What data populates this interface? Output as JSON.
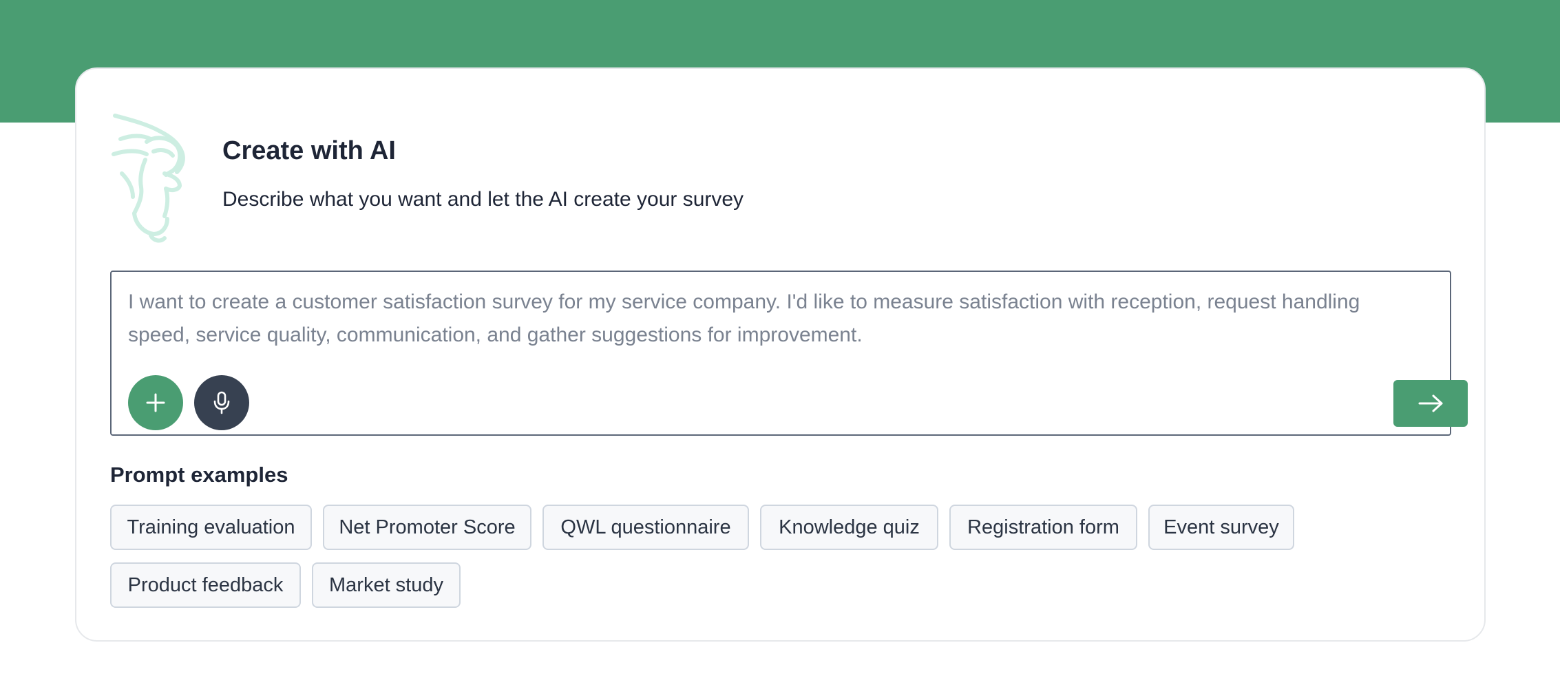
{
  "header": {
    "title": "Create with AI",
    "subtitle": "Describe what you want and let the AI create your survey"
  },
  "prompt": {
    "placeholder": "I want to create a customer satisfaction survey for my service company. I'd like to measure satisfaction with reception, request handling speed, service quality, communication, and gather suggestions for improvement.",
    "add_icon": "plus-icon",
    "mic_icon": "microphone-icon",
    "send_icon": "arrow-right-icon"
  },
  "examples": {
    "label": "Prompt examples",
    "items": [
      "Training evaluation",
      "Net Promoter Score",
      "QWL questionnaire",
      "Knowledge quiz",
      "Registration form",
      "Event survey",
      "Product feedback",
      "Market study"
    ]
  },
  "colors": {
    "brand_green": "#4a9d72",
    "dark_button": "#374151",
    "mascot_tint": "#cdeee2"
  }
}
